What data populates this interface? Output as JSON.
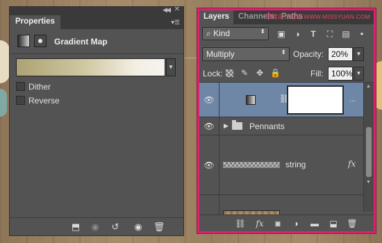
{
  "colors": {
    "panel_bg": "#535353",
    "panel_header": "#3a3a3a",
    "selected_layer": "#6e87a6",
    "highlight_border": "#e0206f",
    "watermark": "#e8486c"
  },
  "properties": {
    "tab_label": "Properties",
    "title": "Gradient Map",
    "icons": [
      "adjustment-icon",
      "mask-icon"
    ],
    "options": [
      {
        "label": "Dither",
        "checked": false
      },
      {
        "label": "Reverse",
        "checked": false
      }
    ],
    "footer_icons": [
      "clip-to-layer-icon",
      "view-previous-icon",
      "reset-icon",
      "visibility-icon",
      "trash-icon"
    ]
  },
  "layers": {
    "tabs": [
      "Layers",
      "Channels",
      "Paths"
    ],
    "watermark": "思缘设计论坛 WWW.MISSYUAN.COM",
    "filter": {
      "kind_label": "Kind"
    },
    "blend_mode": "Multiply",
    "opacity_label": "Opacity:",
    "opacity_value": "20%",
    "lock_label": "Lock:",
    "fill_label": "Fill:",
    "fill_value": "100%",
    "items": [
      {
        "name": "",
        "type": "gradient-map-adjustment",
        "visible": true,
        "selected": true
      },
      {
        "name": "Pennants",
        "type": "group",
        "visible": true,
        "selected": false
      },
      {
        "name": "string",
        "type": "layer",
        "has_fx": true,
        "fx_label": "fx",
        "visible": true,
        "selected": false
      },
      {
        "name": "",
        "type": "layer",
        "visible": false,
        "selected": false
      }
    ],
    "more_label": "...",
    "footer_icons": [
      "link-icon",
      "fx-icon",
      "add-mask-icon",
      "adjustment-layer-icon",
      "new-group-icon",
      "new-layer-icon",
      "trash-icon"
    ]
  }
}
